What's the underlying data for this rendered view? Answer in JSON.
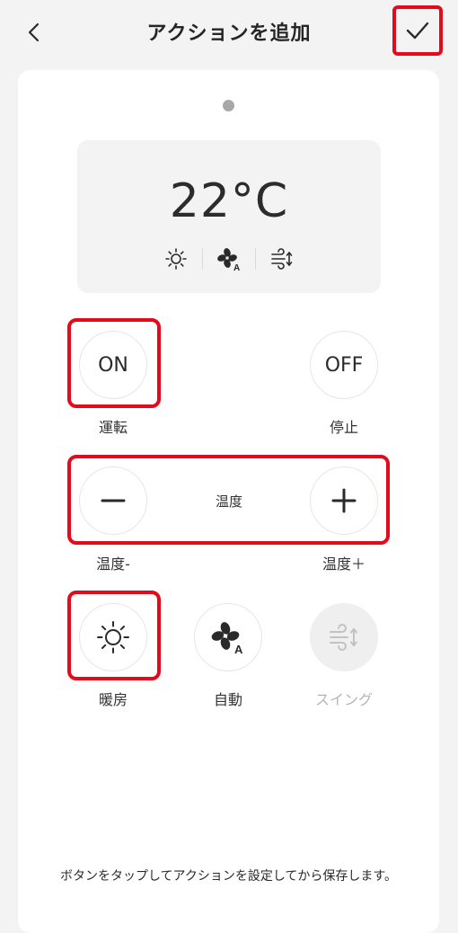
{
  "header": {
    "title": "アクションを追加",
    "back_icon": "chevron-left-icon",
    "confirm_icon": "checkmark-icon"
  },
  "status": {
    "temperature": "22°C",
    "icons": [
      "sun-icon",
      "fan-auto-icon",
      "swing-icon"
    ]
  },
  "power": {
    "on_label": "ON",
    "on_caption": "運転",
    "off_label": "OFF",
    "off_caption": "停止"
  },
  "temperature_control": {
    "center_label": "温度",
    "minus_caption": "温度-",
    "plus_caption": "温度＋"
  },
  "modes": {
    "heat_caption": "暖房",
    "auto_caption": "自動",
    "swing_caption": "スイング"
  },
  "footer": {
    "hint": "ボタンをタップしてアクションを設定してから保存します。"
  },
  "colors": {
    "highlight": "#e30b1b",
    "background": "#f3f3f3",
    "panel": "#ffffff",
    "disabled": "#b5b5b5"
  }
}
